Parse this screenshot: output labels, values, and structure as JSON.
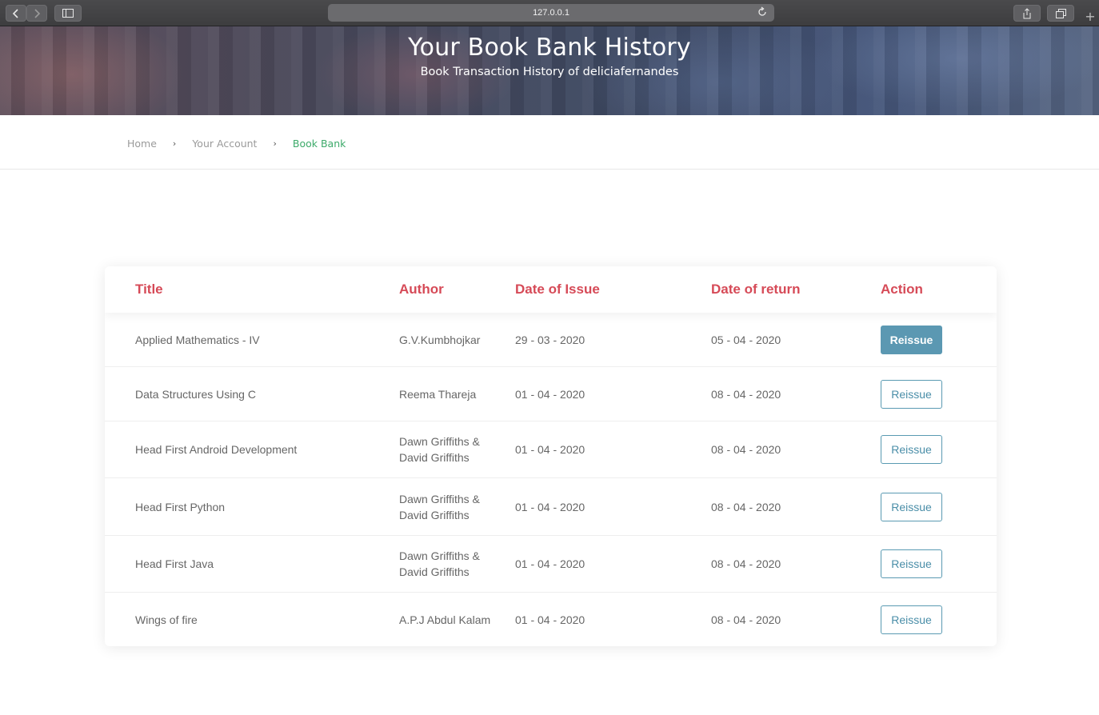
{
  "browser": {
    "url": "127.0.0.1"
  },
  "header": {
    "title": "Your Book Bank History",
    "subtitle": "Book Transaction History of deliciafernandes"
  },
  "breadcrumb": {
    "items": [
      "Home",
      "Your Account",
      "Book Bank"
    ],
    "separator": "›"
  },
  "table": {
    "headers": {
      "title": "Title",
      "author": "Author",
      "issue": "Date of Issue",
      "return": "Date of return",
      "action": "Action"
    },
    "rows": [
      {
        "title": "Applied Mathematics - IV",
        "author": "G.V.Kumbhojkar",
        "issue": "29 - 03 - 2020",
        "return": "05 - 04 - 2020",
        "action": "Reissue"
      },
      {
        "title": "Data Structures Using C",
        "author": "Reema Thareja",
        "issue": "01 - 04 - 2020",
        "return": "08 - 04 - 2020",
        "action": "Reissue"
      },
      {
        "title": "Head First Android Development",
        "author": "Dawn Griffiths & David Griffiths",
        "issue": "01 - 04 - 2020",
        "return": "08 - 04 - 2020",
        "action": "Reissue"
      },
      {
        "title": "Head First Python",
        "author": "Dawn Griffiths & David Griffiths",
        "issue": "01 - 04 - 2020",
        "return": "08 - 04 - 2020",
        "action": "Reissue"
      },
      {
        "title": "Head First Java",
        "author": "Dawn Griffiths & David Griffiths",
        "issue": "01 - 04 - 2020",
        "return": "08 - 04 - 2020",
        "action": "Reissue"
      },
      {
        "title": "Wings of fire",
        "author": "A.P.J Abdul Kalam",
        "issue": "01 - 04 - 2020",
        "return": "08 - 04 - 2020",
        "action": "Reissue"
      }
    ]
  },
  "colors": {
    "header_text": "#d64a57",
    "breadcrumb_active": "#3daa6a",
    "button_accent": "#5b98b2"
  },
  "icons": [
    "back-icon",
    "forward-icon",
    "sidebar-icon",
    "reload-icon",
    "share-icon",
    "tabs-icon",
    "new-tab-icon"
  ]
}
